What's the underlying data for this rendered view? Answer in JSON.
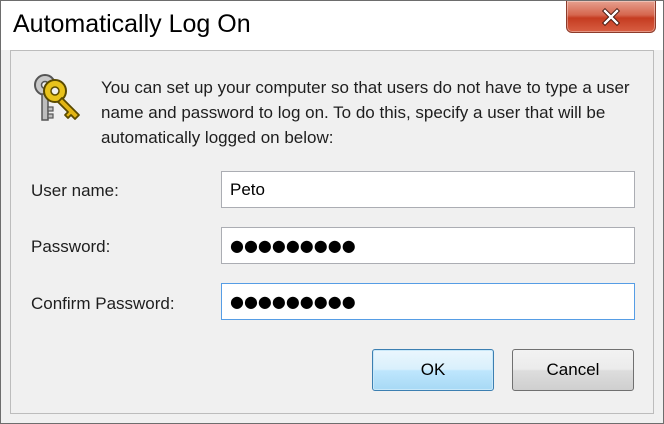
{
  "window": {
    "title": "Automatically Log On"
  },
  "icons": {
    "close": "close-icon",
    "keys": "keys-icon"
  },
  "colors": {
    "close_button": "#c53c21",
    "ok_button": "#bee6fd",
    "focus_border": "#569de5"
  },
  "description": "You can set up your computer so that users do not have to type a user name and password to log on. To do this, specify a user that will be automatically logged on below:",
  "fields": {
    "username": {
      "label": "User name:",
      "value": "Peto"
    },
    "password": {
      "label": "Password:",
      "value": "●●●●●●●●●"
    },
    "confirm": {
      "label": "Confirm Password:",
      "value": "●●●●●●●●●"
    }
  },
  "buttons": {
    "ok": "OK",
    "cancel": "Cancel"
  }
}
